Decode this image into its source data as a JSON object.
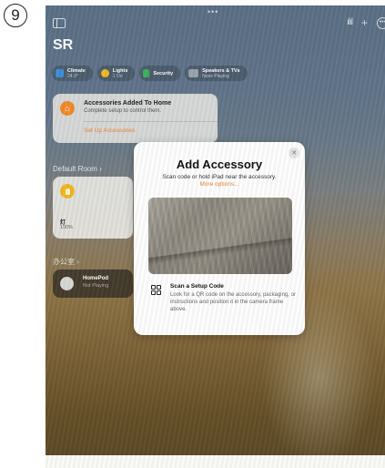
{
  "step_number": "9",
  "top_bar": {
    "icons": [
      "sidebar-icon",
      "waveform-icon",
      "plus-icon",
      "more-icon"
    ]
  },
  "home": {
    "title": "SR"
  },
  "categories": [
    {
      "label": "Climate",
      "sub": "24.0°",
      "icon": "climate-icon",
      "color": "#3a8fd8"
    },
    {
      "label": "Lights",
      "sub": "1 On",
      "icon": "lightbulb-icon",
      "color": "#f2b824"
    },
    {
      "label": "Security",
      "sub": "",
      "icon": "lock-icon",
      "color": "#3cb35a"
    },
    {
      "label": "Speakers & TVs",
      "sub": "None Playing",
      "icon": "tv-icon",
      "color": "#9aa2ab"
    }
  ],
  "notice": {
    "title": "Accessories Added To Home",
    "subtitle": "Complete setup to control them.",
    "link": "Set Up Accessories"
  },
  "rooms": {
    "default_room": "Default Room",
    "default_chevron": "›",
    "light_name": "灯",
    "light_value": "100%",
    "office": "办公室",
    "office_chevron": "›",
    "homepod_name": "HomePod",
    "homepod_status": "Not Playing"
  },
  "modal": {
    "close": "✕",
    "title": "Add Accessory",
    "subtitle": "Scan code or hold iPad near the accessory.",
    "link": "More options...",
    "scan_title": "Scan a Setup Code",
    "scan_description": "Look for a QR code on the accessory, packaging, or instructions and position it in the camera frame above."
  }
}
